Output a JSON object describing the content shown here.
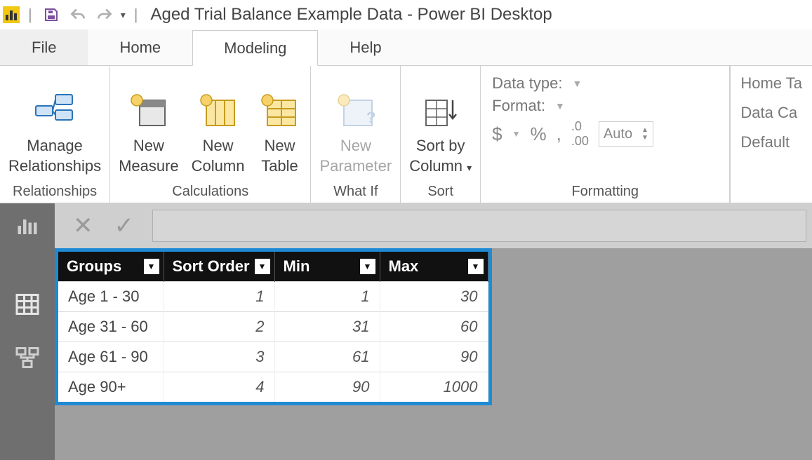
{
  "titlebar": {
    "app_title": "Aged Trial Balance Example Data - Power BI Desktop"
  },
  "tabs": {
    "file": "File",
    "home": "Home",
    "modeling": "Modeling",
    "help": "Help"
  },
  "ribbon": {
    "relationships": {
      "manage": "Manage\nRelationships",
      "group": "Relationships"
    },
    "calculations": {
      "measure": "New\nMeasure",
      "column": "New\nColumn",
      "table": "New\nTable",
      "group": "Calculations"
    },
    "whatif": {
      "parameter": "New\nParameter",
      "group": "What If"
    },
    "sort": {
      "sortby": "Sort by\nColumn",
      "group": "Sort"
    },
    "formatting": {
      "datatype": "Data type:",
      "format": "Format:",
      "auto": "Auto",
      "group": "Formatting"
    },
    "properties": {
      "home_table": "Home Ta",
      "data_cat": "Data Ca",
      "default": "Default"
    }
  },
  "table": {
    "headers": {
      "groups": "Groups",
      "sort": "Sort Order",
      "min": "Min",
      "max": "Max"
    },
    "rows": [
      {
        "groups": "Age 1 - 30",
        "sort": "1",
        "min": "1",
        "max": "30"
      },
      {
        "groups": "Age 31 - 60",
        "sort": "2",
        "min": "31",
        "max": "60"
      },
      {
        "groups": "Age 61 - 90",
        "sort": "3",
        "min": "61",
        "max": "90"
      },
      {
        "groups": "Age 90+",
        "sort": "4",
        "min": "90",
        "max": "1000"
      }
    ]
  }
}
